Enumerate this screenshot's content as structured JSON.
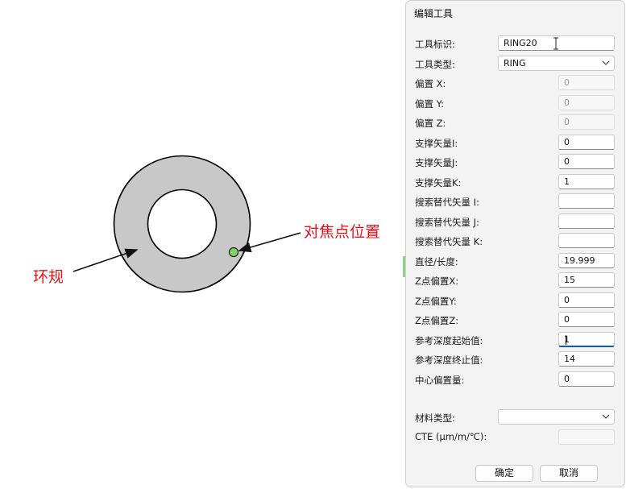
{
  "annotations": {
    "ring_label": "环规",
    "focus_label": "对焦点位置"
  },
  "dialog": {
    "title": "编辑工具",
    "fields": [
      {
        "id": "tool-id",
        "label": "工具标识:",
        "value": "RING20",
        "kind": "text"
      },
      {
        "id": "tool-type",
        "label": "工具类型:",
        "value": "RING",
        "kind": "select"
      },
      {
        "id": "offset-x",
        "label": "偏置 X:",
        "value": "0",
        "kind": "disabled"
      },
      {
        "id": "offset-y",
        "label": "偏置 Y:",
        "value": "0",
        "kind": "disabled"
      },
      {
        "id": "offset-z",
        "label": "偏置 Z:",
        "value": "0",
        "kind": "disabled"
      },
      {
        "id": "support-i",
        "label": "支撑矢量I:",
        "value": "0",
        "kind": "text"
      },
      {
        "id": "support-j",
        "label": "支撑矢量J:",
        "value": "0",
        "kind": "text"
      },
      {
        "id": "support-k",
        "label": "支撑矢量K:",
        "value": "1",
        "kind": "text"
      },
      {
        "id": "search-i",
        "label": "搜索替代矢量 I:",
        "value": "",
        "kind": "text"
      },
      {
        "id": "search-j",
        "label": "搜索替代矢量 J:",
        "value": "",
        "kind": "text"
      },
      {
        "id": "search-k",
        "label": "搜索替代矢量 K:",
        "value": "",
        "kind": "text"
      },
      {
        "id": "diameter",
        "label": "直径/长度:",
        "value": "19.999",
        "kind": "text"
      },
      {
        "id": "z-offset-x",
        "label": "Z点偏置X:",
        "value": "15",
        "kind": "text"
      },
      {
        "id": "z-offset-y",
        "label": "Z点偏置Y:",
        "value": "0",
        "kind": "text"
      },
      {
        "id": "z-offset-z",
        "label": "Z点偏置Z:",
        "value": "0",
        "kind": "text"
      },
      {
        "id": "ref-depth-start",
        "label": "参考深度起始值:",
        "value": "1",
        "kind": "focused"
      },
      {
        "id": "ref-depth-end",
        "label": "参考深度终止值:",
        "value": "14",
        "kind": "text"
      },
      {
        "id": "center-offset",
        "label": "中心偏置量:",
        "value": "0",
        "kind": "text"
      }
    ],
    "material": {
      "label": "材料类型:",
      "value": ""
    },
    "cte": {
      "label": "CTE  (µm/m/℃):",
      "value": ""
    },
    "ok_label": "确定",
    "cancel_label": "取消"
  },
  "colors": {
    "annotation": "#e8141b",
    "ring_fill": "#c8c8c8",
    "focus_point": "#7fd46a",
    "focus_underline": "#005fb8"
  }
}
